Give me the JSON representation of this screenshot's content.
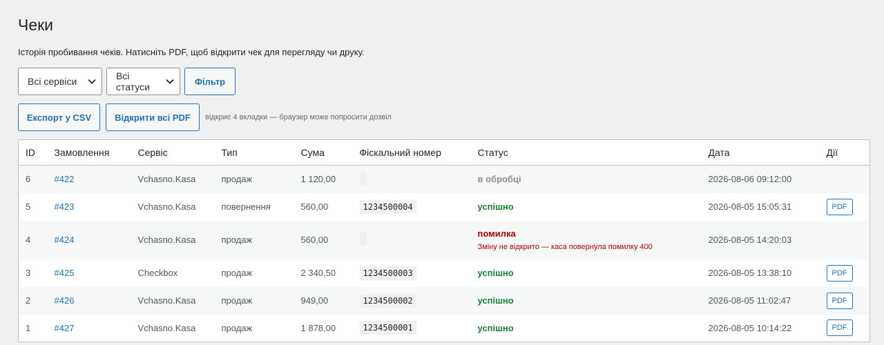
{
  "page": {
    "title": "Чеки",
    "description": "Історія пробивання чеків. Натисніть PDF, щоб відкрити чек для перегляду чи друку."
  },
  "filters": {
    "service_select": "Всі сервіси",
    "status_select": "Всі статуси",
    "filter_button": "Фільтр"
  },
  "actions": {
    "export_csv": "Експорт у CSV",
    "open_all_pdf": "Відкрити всі PDF",
    "hint": "відкриє 4 вкладки — браузер може попросити дозвіл"
  },
  "table": {
    "headers": [
      "ID",
      "Замовлення",
      "Сервіс",
      "Тип",
      "Сума",
      "Фіскальний номер",
      "Статус",
      "Дата",
      "Дії"
    ],
    "rows": [
      {
        "id": "6",
        "order": "#422",
        "service": "Vchasno.Kasa",
        "type": "продаж",
        "sum": "1 120,00",
        "fiscal": "",
        "status": "в обробці",
        "status_kind": "processing",
        "error": "",
        "date": "2026-08-06 09:12:00",
        "action": ""
      },
      {
        "id": "5",
        "order": "#423",
        "service": "Vchasno.Kasa",
        "type": "повернення",
        "sum": "560,00",
        "fiscal": "1234500004",
        "status": "успішно",
        "status_kind": "success",
        "error": "",
        "date": "2026-08-05 15:05:31",
        "action": "PDF"
      },
      {
        "id": "4",
        "order": "#424",
        "service": "Vchasno.Kasa",
        "type": "продаж",
        "sum": "560,00",
        "fiscal": "",
        "status": "помилка",
        "status_kind": "error",
        "error": "Зміну не відкрито — каса повернула помилку 400",
        "date": "2026-08-05 14:20:03",
        "action": ""
      },
      {
        "id": "3",
        "order": "#425",
        "service": "Checkbox",
        "type": "продаж",
        "sum": "2 340,50",
        "fiscal": "1234500003",
        "status": "успішно",
        "status_kind": "success",
        "error": "",
        "date": "2026-08-05 13:38:10",
        "action": "PDF"
      },
      {
        "id": "2",
        "order": "#426",
        "service": "Vchasno.Kasa",
        "type": "продаж",
        "sum": "949,00",
        "fiscal": "1234500002",
        "status": "успішно",
        "status_kind": "success",
        "error": "",
        "date": "2026-08-05 11:02:47",
        "action": "PDF"
      },
      {
        "id": "1",
        "order": "#427",
        "service": "Vchasno.Kasa",
        "type": "продаж",
        "sum": "1 878,00",
        "fiscal": "1234500001",
        "status": "успішно",
        "status_kind": "success",
        "error": "",
        "date": "2026-08-05 10:14:22",
        "action": "PDF"
      }
    ]
  },
  "colors": {
    "accent": "#2271b1",
    "success": "#1a7f37",
    "error": "#aa0000",
    "processing": "#8c8f94"
  }
}
